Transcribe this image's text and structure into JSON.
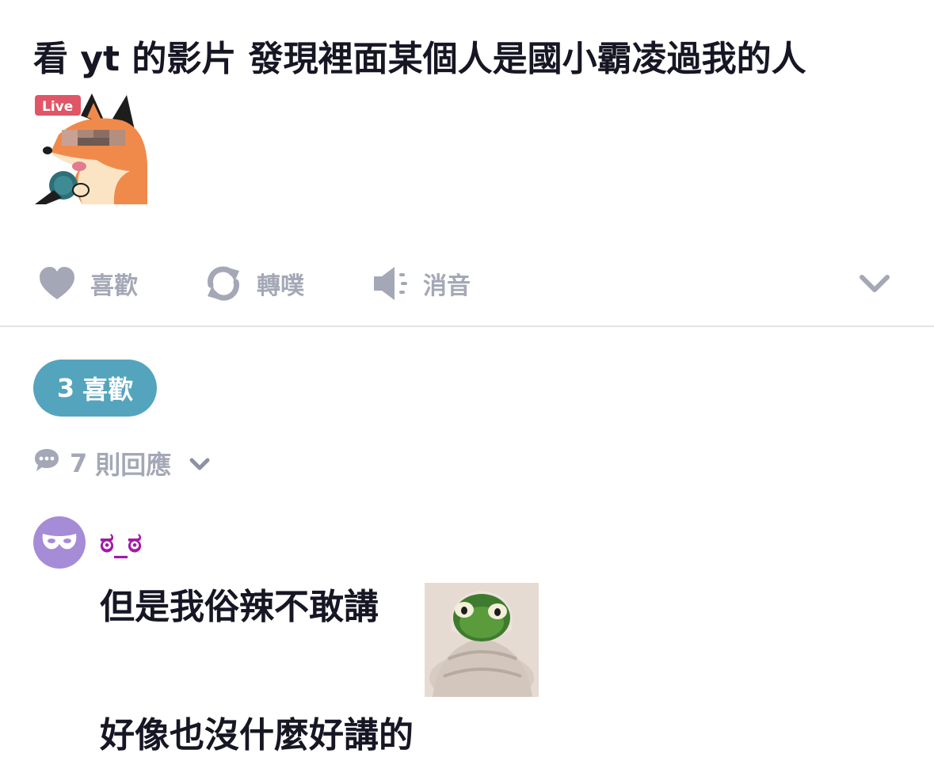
{
  "post": {
    "title": "看 yt 的影片 發現裡面某個人是國小霸凌過我的人",
    "sticker_icon": "fox-live-microphone-sticker"
  },
  "actions": {
    "like_label": "喜歡",
    "repost_label": "轉噗",
    "mute_label": "消音",
    "like_icon": "heart-icon",
    "repost_icon": "repost-icon",
    "mute_icon": "speaker-mute-icon",
    "more_icon": "chevron-down-icon"
  },
  "likes": {
    "count": "3",
    "label": "喜歡",
    "color": "#55a4bd"
  },
  "replies": {
    "count": "7",
    "label": "則回應",
    "icon": "speech-bubble-icon"
  },
  "comment": {
    "author": "ಠ_ಠ",
    "author_color": "#a21aa6",
    "avatar_icon": "mask-icon",
    "line1": "但是我俗辣不敢講",
    "line2": "好像也沒什麼好講的",
    "sticker_icon": "frog-in-blanket-sticker"
  }
}
